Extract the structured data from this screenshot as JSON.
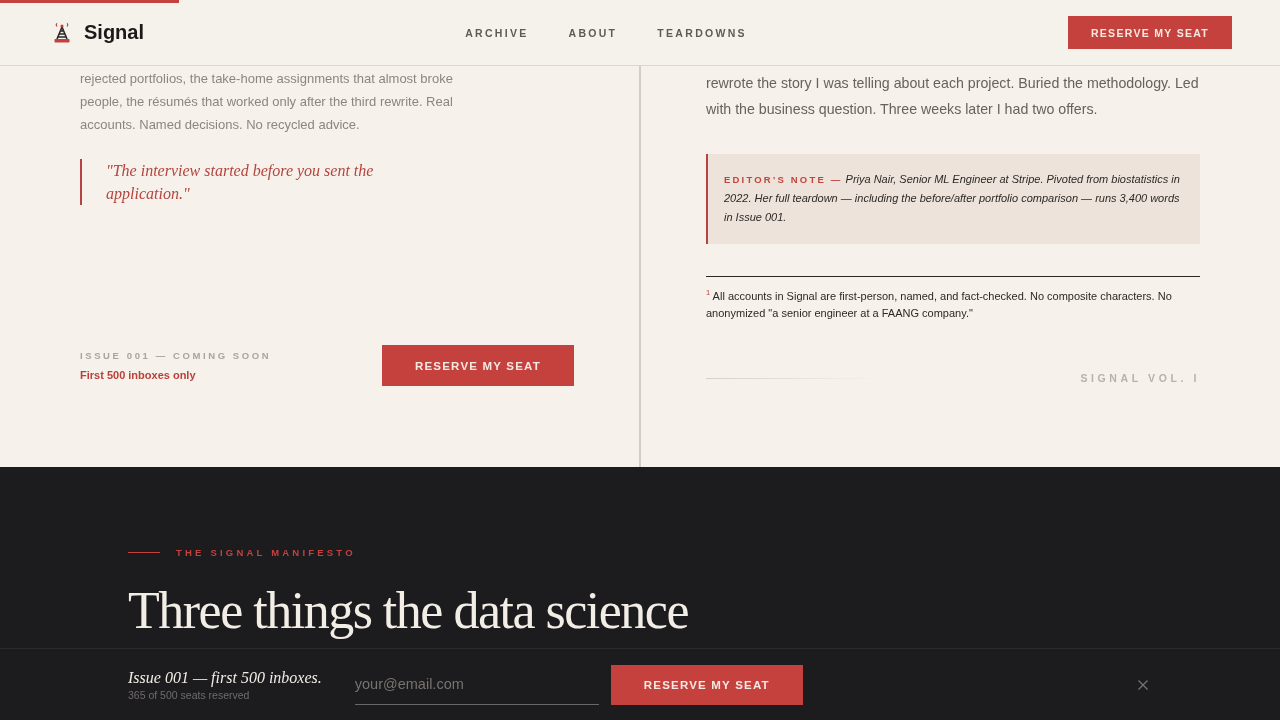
{
  "reading_progress": {
    "level": 0.14
  },
  "header": {
    "brand": "Signal",
    "nav": [
      {
        "label": "ARCHIVE"
      },
      {
        "label": "ABOUT"
      },
      {
        "label": "TEARDOWNS"
      }
    ],
    "cta": "RESERVE MY SEAT"
  },
  "story": {
    "left": {
      "paragraph": "rejected portfolios, the take-home assignments that almost broke people, the résumés that worked only after the third rewrite. Real accounts. Named decisions. No recycled advice.",
      "pull_quote": "\"The interview started before you sent the application.\"",
      "issue_label": "ISSUE 001 — COMING SOON",
      "scarcity_note": "First 500 inboxes only",
      "cta": "RESERVE MY SEAT"
    },
    "right": {
      "paragraph": "rewrote the story I was telling about each project. Buried the methodology. Led with the business question. Three weeks later I had two offers.",
      "editor_note": "**EDITOR'S NOTE —** Priya Nair, Senior ML Engineer at Stripe. Pivoted from biostatistics in 2022. Her full teardown — including the before/after portfolio comparison — runs 3,400 words in Issue 001.",
      "footnote": "$^{1}$ All accounts in Signal are first-person, named, and fact-checked. No composite characters. No anonymized \"a senior engineer at a FAANG company.\"",
      "signature": "SIGNAL VOL. I"
    }
  },
  "manifesto": {
    "eyebrow": "THE SIGNAL MANIFESTO",
    "heading": "Three things the data science"
  },
  "sticky_bar": {
    "title": "Issue 001 — first 500 inboxes.",
    "seats": "365 of 500 seats reserved",
    "email": {
      "placeholder": "your@email.com"
    },
    "cta": "RESERVE MY SEAT"
  }
}
